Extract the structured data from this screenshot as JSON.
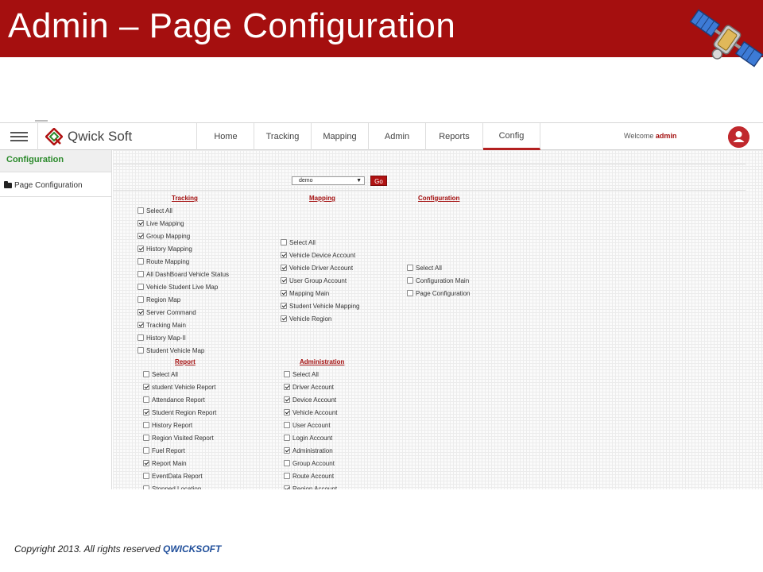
{
  "slide": {
    "title": "Admin – Page Configuration",
    "footer_text": "Copyright 2013. All rights reserved ",
    "footer_brand": "QWICKSOFT"
  },
  "navbar": {
    "brand": "Qwick Soft",
    "items": [
      {
        "label": "Home",
        "active": false
      },
      {
        "label": "Tracking",
        "active": false
      },
      {
        "label": "Mapping",
        "active": false
      },
      {
        "label": "Admin",
        "active": false
      },
      {
        "label": "Reports",
        "active": false
      },
      {
        "label": "Config",
        "active": true
      }
    ],
    "welcome_prefix": "Welcome ",
    "username": "admin"
  },
  "sidebar": {
    "heading": "Configuration",
    "items": [
      {
        "label": "Page Configuration",
        "icon": "folder-icon"
      }
    ]
  },
  "form": {
    "select_value": "demo",
    "go_label": "Go"
  },
  "groups": {
    "tracking": {
      "title": "Tracking",
      "items": [
        {
          "label": "Select All",
          "checked": false
        },
        {
          "label": "Live Mapping",
          "checked": true
        },
        {
          "label": "Group Mapping",
          "checked": true
        },
        {
          "label": "History Mapping",
          "checked": true
        },
        {
          "label": "Route Mapping",
          "checked": false
        },
        {
          "label": "All DashBoard Vehicle Status",
          "checked": false
        },
        {
          "label": "Vehicle Student Live Map",
          "checked": false
        },
        {
          "label": "Region Map",
          "checked": false
        },
        {
          "label": "Server Command",
          "checked": true
        },
        {
          "label": "Tracking Main",
          "checked": true
        },
        {
          "label": "History Map-II",
          "checked": false
        },
        {
          "label": "Student Vehicle Map",
          "checked": false
        }
      ]
    },
    "mapping": {
      "title": "Mapping",
      "items": [
        {
          "label": "Select All",
          "checked": false
        },
        {
          "label": "Vehicle Device Account",
          "checked": true
        },
        {
          "label": "Vehicle Driver Account",
          "checked": true
        },
        {
          "label": "User Group Account",
          "checked": true
        },
        {
          "label": "Mapping Main",
          "checked": true
        },
        {
          "label": "Student Vehicle Mapping",
          "checked": true
        },
        {
          "label": "Vehicle Region",
          "checked": true
        }
      ]
    },
    "configuration": {
      "title": "Configuration",
      "items": [
        {
          "label": "Select All",
          "checked": false
        },
        {
          "label": "Configuration Main",
          "checked": false
        },
        {
          "label": "Page Configuration",
          "checked": false
        }
      ]
    },
    "report": {
      "title": "Report",
      "items": [
        {
          "label": "Select All",
          "checked": false
        },
        {
          "label": "student Vehicle Report",
          "checked": true
        },
        {
          "label": "Attendance Report",
          "checked": false
        },
        {
          "label": "Student Region Report",
          "checked": true
        },
        {
          "label": "History Report",
          "checked": false
        },
        {
          "label": "Region Visited Report",
          "checked": false
        },
        {
          "label": "Fuel Report",
          "checked": false
        },
        {
          "label": "Report Main",
          "checked": true
        },
        {
          "label": "EventData Report",
          "checked": false
        },
        {
          "label": "Stopped Location",
          "checked": false
        }
      ]
    },
    "administration": {
      "title": "Administration",
      "items": [
        {
          "label": "Select All",
          "checked": false
        },
        {
          "label": "Driver Account",
          "checked": true
        },
        {
          "label": "Device Account",
          "checked": true
        },
        {
          "label": "Vehicle Account",
          "checked": true
        },
        {
          "label": "User Account",
          "checked": false
        },
        {
          "label": "Login Account",
          "checked": false
        },
        {
          "label": "Administration",
          "checked": true
        },
        {
          "label": "Group Account",
          "checked": false
        },
        {
          "label": "Route Account",
          "checked": false
        },
        {
          "label": "Region Account",
          "checked": true
        }
      ]
    }
  },
  "colors": {
    "header_red": "#a50f0f",
    "accent_red": "#b01212",
    "sidebar_heading_green": "#2b8a2b",
    "footer_brand_blue": "#1f4e9a"
  }
}
